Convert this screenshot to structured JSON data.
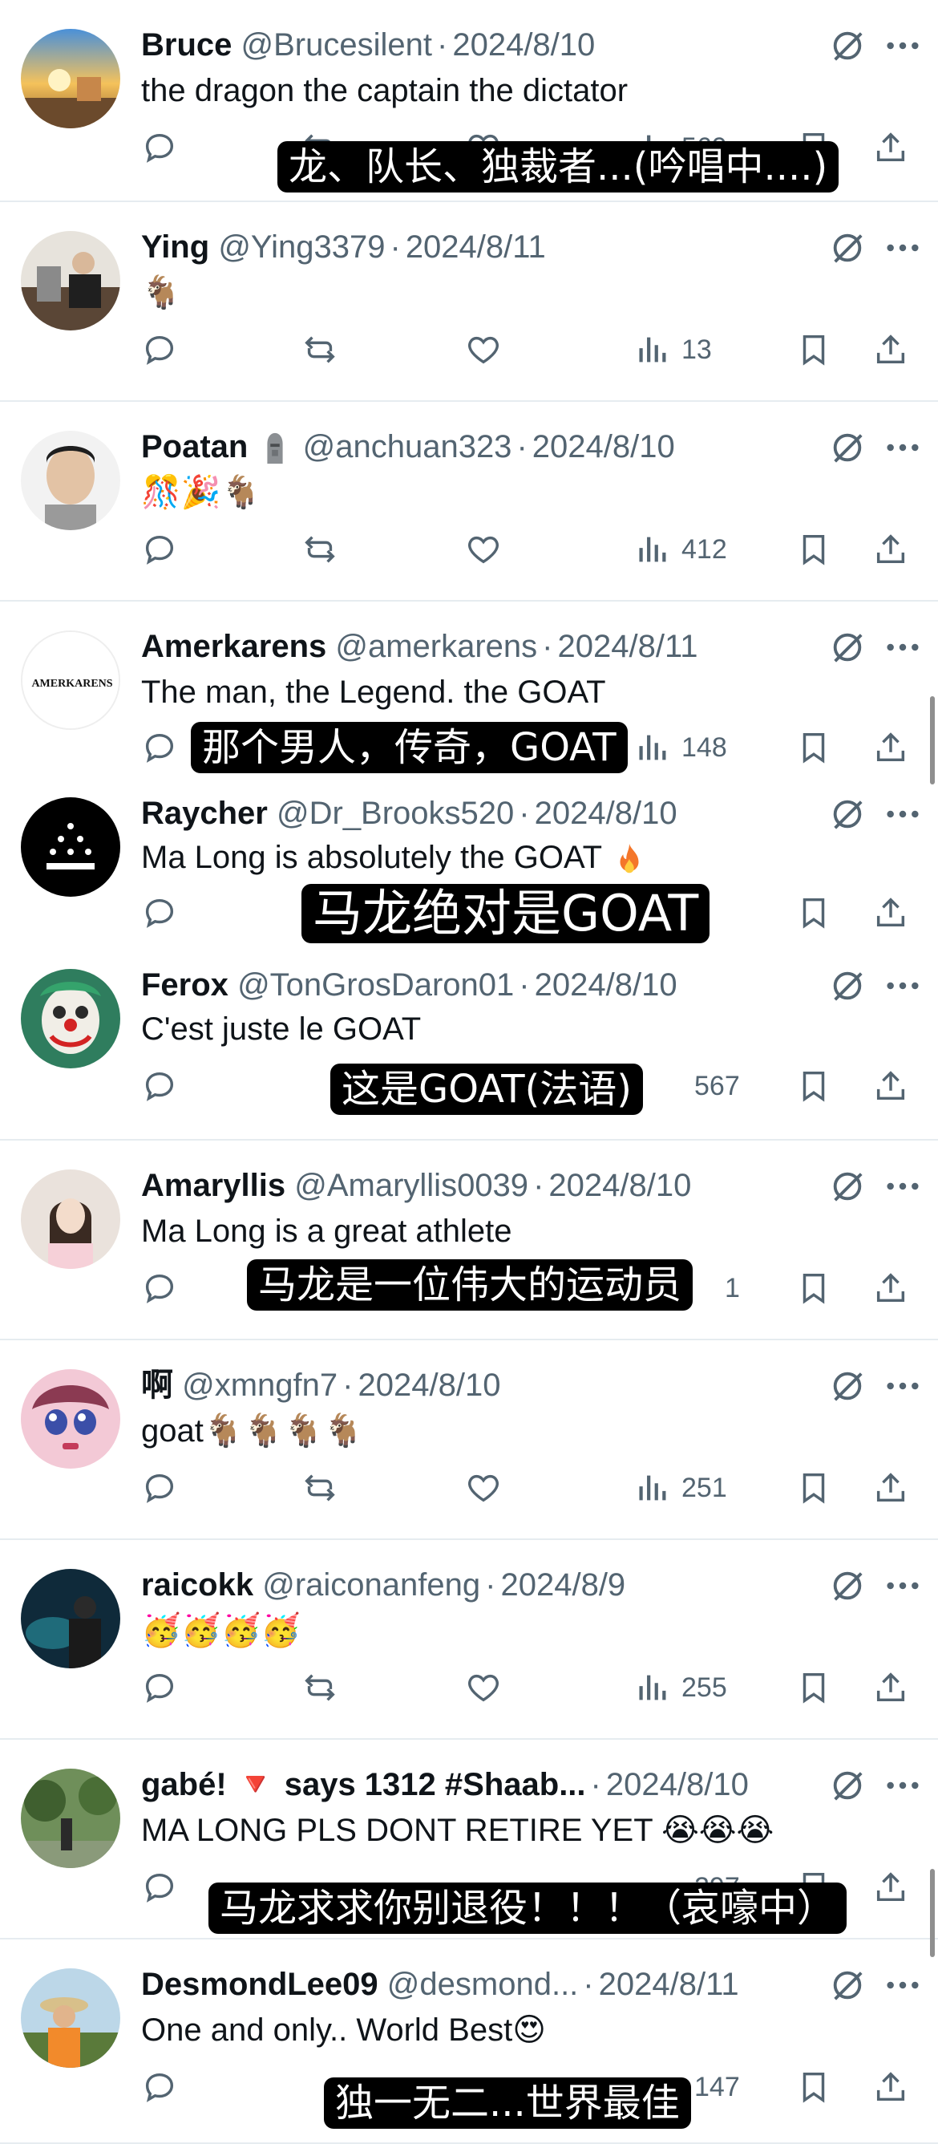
{
  "tweets": [
    {
      "name": "Bruce",
      "handle": "@Brucesilent",
      "date": "2024/8/10",
      "text": "the dragon  the captain  the dictator",
      "views": "569",
      "subtitle": "龙、队长、独裁者...(吟唱中....)"
    },
    {
      "name": "Ying",
      "handle": "@Ying3379",
      "date": "2024/8/11",
      "text": "🐐",
      "views": "13"
    },
    {
      "name": "Poatan",
      "handle": "@anchuan323",
      "date": "2024/8/10",
      "text": "🎊🎉🐐",
      "views": "412"
    },
    {
      "name": "Amerkarens",
      "handle": "@amerkarens",
      "date": "2024/8/11",
      "text": "The man, the Legend. the GOAT",
      "views": "148",
      "subtitle": "那个男人，传奇，GOAT",
      "avatar_text": "AMERKARENS"
    },
    {
      "name": "Raycher",
      "handle": "@Dr_Brooks520",
      "date": "2024/8/10",
      "text": "Ma Long is absolutely the GOAT",
      "subtitle": "马龙绝对是GOAT"
    },
    {
      "name": "Ferox",
      "handle": "@TonGrosDaron01",
      "date": "2024/8/10",
      "text": "C'est juste le GOAT",
      "views": "567",
      "subtitle": "这是GOAT(法语)"
    },
    {
      "name": "Amaryllis",
      "handle": "@Amaryllis0039",
      "date": "2024/8/10",
      "text": "Ma Long is a great athlete",
      "views": "1",
      "subtitle": "马龙是一位伟大的运动员"
    },
    {
      "name": "啊",
      "handle": "@xmngfn7",
      "date": "2024/8/10",
      "text": "goat🐐🐐🐐🐐",
      "views": "251"
    },
    {
      "name": "raicokk",
      "handle": "@raiconanfeng",
      "date": "2024/8/9",
      "text": "🥳🥳🥳🥳",
      "views": "255"
    },
    {
      "name": "gabé! 🔻 says 1312 #Shaab...",
      "handle": "",
      "date": "2024/8/10",
      "text": "MA LONG PLS DONT RETIRE YET 😭😭😭",
      "views": "297",
      "subtitle": "马龙求求你别退役！！！（哀嚎中）"
    },
    {
      "name": "DesmondLee09",
      "handle": "@desmond...",
      "date": "2024/8/11",
      "text": "One and only.. World Best😍",
      "views": "147",
      "subtitle": "独一无二...世界最佳"
    }
  ],
  "icons": {
    "reply": "reply-icon",
    "retweet": "retweet-icon",
    "like": "heart-icon",
    "views": "views-icon",
    "bookmark": "bookmark-icon",
    "share": "share-icon",
    "grok": "grok-icon",
    "more": "more-icon"
  },
  "colors": {
    "text": "#0f1419",
    "secondary": "#536471",
    "divider": "#e6ecf0",
    "subtitle_bg": "#000000"
  }
}
